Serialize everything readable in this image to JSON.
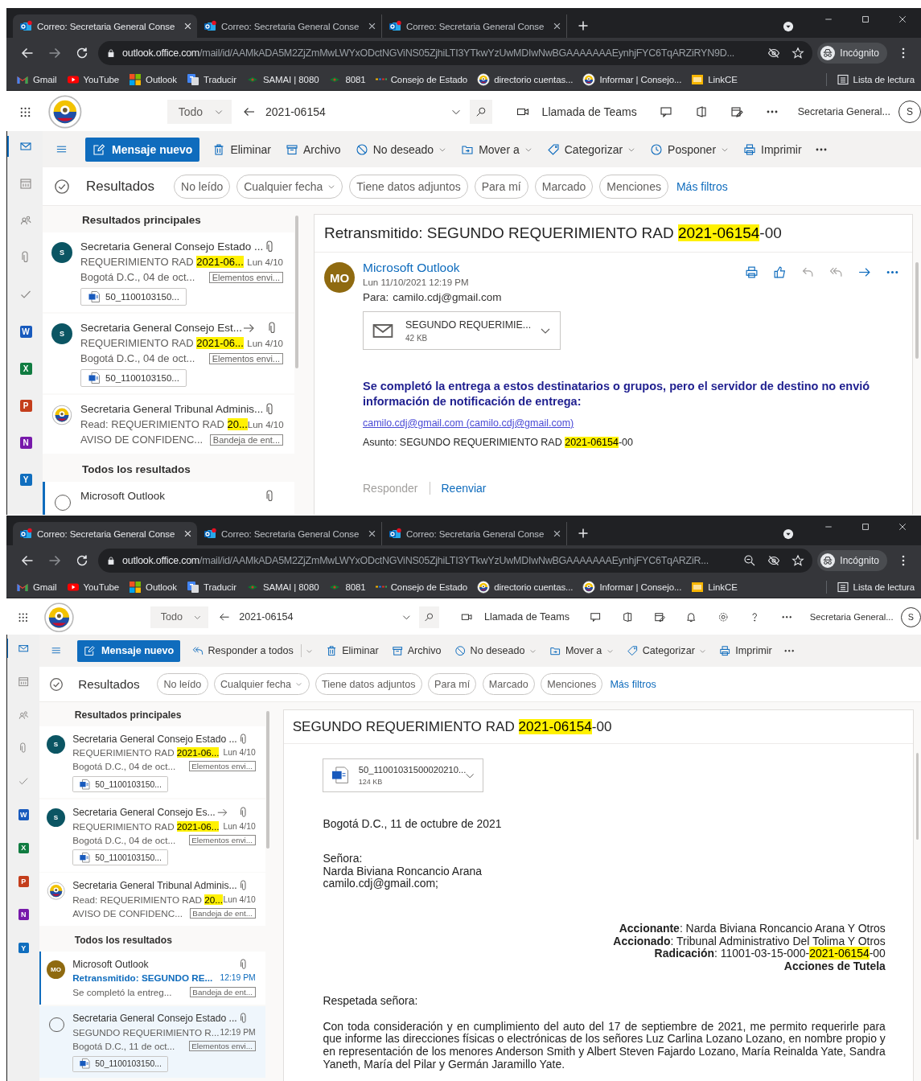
{
  "screens": [
    {
      "browser": {
        "tabs": [
          {
            "title": "Correo: Secretaria General Conse",
            "selected": true
          },
          {
            "title": "Correo: Secretaria General Conse",
            "selected": false
          },
          {
            "title": "Correo: Secretaria General Conse",
            "selected": false
          }
        ],
        "url_host": "outlook.office.com",
        "url_path": "/mail/id/AAMkADA5M2ZjZmMwLWYxODctNGViNS05ZjhiLTI3YTkwYzUwMDIwNwBGAAAAAAAEynhjFYC6TqARZiRYN9D...",
        "profile": "Incógnito",
        "bookmarks": [
          {
            "label": "Gmail"
          },
          {
            "label": "YouTube"
          },
          {
            "label": "Outlook"
          },
          {
            "label": "Traducir"
          },
          {
            "label": "SAMAI | 8080"
          },
          {
            "label": "8081"
          },
          {
            "label": "Consejo de Estado"
          },
          {
            "label": "directorio cuentas..."
          },
          {
            "label": "Informar | Consejo..."
          },
          {
            "label": "LinkCE"
          }
        ],
        "reading_list": "Lista de lectura"
      },
      "outlook": {
        "search_scope": "Todo",
        "search_query": "2021-06154",
        "teams": "Llamada de Teams",
        "account": "Secretaria General...",
        "account_initial": "S",
        "rail": [
          {
            "kind": "mail",
            "selected": true
          },
          {
            "kind": "calendar",
            "selected": false
          },
          {
            "kind": "people",
            "selected": false
          },
          {
            "kind": "clip",
            "selected": false
          },
          {
            "kind": "check",
            "selected": false
          },
          {
            "kind": "app",
            "letter": "W",
            "color": "#185abd",
            "selected": false
          },
          {
            "kind": "app",
            "letter": "X",
            "color": "#107c41",
            "selected": false
          },
          {
            "kind": "app",
            "letter": "P",
            "color": "#c43e1c",
            "selected": false
          },
          {
            "kind": "app",
            "letter": "N",
            "color": "#7719aa",
            "selected": false
          },
          {
            "kind": "app",
            "letter": "Y",
            "color": "#106ebe",
            "selected": false
          }
        ],
        "new_message": "Mensaje nuevo",
        "commands": [
          {
            "label": "Eliminar",
            "kind": "trash",
            "dropdown": false
          },
          {
            "label": "Archivo",
            "kind": "archive",
            "dropdown": false
          },
          {
            "label": "No deseado",
            "kind": "block",
            "dropdown": true
          },
          {
            "label": "Mover a",
            "kind": "move",
            "dropdown": true
          },
          {
            "label": "Categorizar",
            "kind": "tag",
            "dropdown": true
          },
          {
            "label": "Posponer",
            "kind": "clock",
            "dropdown": true
          },
          {
            "label": "Imprimir",
            "kind": "print",
            "dropdown": false
          }
        ],
        "results_label": "Resultados",
        "filters": [
          {
            "label": "No leído",
            "dropdown": false
          },
          {
            "label": "Cualquier fecha",
            "dropdown": true
          },
          {
            "label": "Tiene datos adjuntos",
            "dropdown": false
          },
          {
            "label": "Para mí",
            "dropdown": false
          },
          {
            "label": "Marcado",
            "dropdown": false
          },
          {
            "label": "Menciones",
            "dropdown": false
          }
        ],
        "more_filters": "Más filtros",
        "sections": [
          {
            "title": "Resultados principales",
            "items": [
              {
                "avatar": {
                  "kind": "initial",
                  "text": "S",
                  "color": "#0b5563"
                },
                "sender": "Secretaria General Consejo Estado ...",
                "forwarded": false,
                "attachment": true,
                "subject": [
                  {
                    "text": "REQUERIMIENTO RAD ",
                    "highlight": false
                  },
                  {
                    "text": "2021-06...",
                    "highlight": true
                  }
                ],
                "date": "Lun 4/10",
                "preview": "Bogotá D.C., 04 de oct...",
                "folder": "Elementos envi...",
                "file": "50_1100103150...",
                "unread": false,
                "selected": false,
                "hovered": false
              },
              {
                "avatar": {
                  "kind": "initial",
                  "text": "S",
                  "color": "#0b5563"
                },
                "sender": "Secretaria General Consejo Est...",
                "forwarded": true,
                "attachment": true,
                "subject": [
                  {
                    "text": "REQUERIMIENTO RAD ",
                    "highlight": false
                  },
                  {
                    "text": "2021-06...",
                    "highlight": true
                  }
                ],
                "date": "Lun 4/10",
                "preview": "Bogotá D.C., 04 de oct...",
                "folder": "Elementos envi...",
                "file": "50_1100103150...",
                "unread": false,
                "selected": false,
                "hovered": false
              },
              {
                "avatar": {
                  "kind": "seal"
                },
                "sender": "Secretaria General Tribunal Adminis...",
                "forwarded": false,
                "attachment": true,
                "subject": [
                  {
                    "text": "Read: REQUERIMIENTO RAD ",
                    "highlight": false
                  },
                  {
                    "text": "20...",
                    "highlight": true
                  }
                ],
                "date": "Lun 4/10",
                "preview": "AVISO DE CONFIDENC...",
                "folder": "Bandeja de ent...",
                "unread": false,
                "selected": false,
                "hovered": false
              }
            ]
          },
          {
            "title": "Todos los resultados",
            "items": [
              {
                "avatar": {
                  "kind": "select"
                },
                "sender": "Microsoft Outlook",
                "forwarded": false,
                "attachment": true,
                "unread": false,
                "selected": true,
                "hovered": false
              }
            ]
          }
        ],
        "reading": {
          "title": [
            {
              "text": "Retransmitido: SEGUNDO REQUERIMIENTO RAD ",
              "highlight": false
            },
            {
              "text": "2021-06154",
              "highlight": true
            },
            {
              "text": "-00",
              "highlight": false
            }
          ],
          "sender": {
            "initials": "MO",
            "color": "#8f6a10",
            "name": "Microsoft Outlook",
            "date": "Lun 11/10/2021 12:19 PM",
            "to_label": "Para:",
            "to": "camilo.cdj@gmail.com"
          },
          "attachment": {
            "kind": "envelope",
            "name": "SEGUNDO REQUERIMIE...",
            "size": "42 KB"
          },
          "body": [
            {
              "kind": "notice",
              "text": "Se completó la entrega a estos destinatarios o grupos, pero el servidor de destino no envió información de notificación de entrega:"
            },
            {
              "kind": "link",
              "text": "camilo.cdj@gmail.com (camilo.cdj@gmail.com)"
            },
            {
              "kind": "line",
              "segments": [
                {
                  "text": "Asunto: SEGUNDO REQUERIMIENTO RAD ",
                  "highlight": false
                },
                {
                  "text": "2021-06154",
                  "highlight": true
                },
                {
                  "text": "-00",
                  "highlight": false
                }
              ]
            }
          ],
          "footer": [
            {
              "label": "Responder",
              "disabled": true
            },
            {
              "label": "Reenviar",
              "disabled": false
            }
          ]
        }
      }
    },
    {
      "browser": {
        "tabs": [
          {
            "title": "Correo: Secretaria General Conse",
            "selected": true
          },
          {
            "title": "Correo: Secretaria General Conse",
            "selected": false
          },
          {
            "title": "Correo: Secretaria General Conse",
            "selected": false
          }
        ],
        "url_host": "outlook.office.com",
        "url_path": "/mail/id/AAMkADA5M2ZjZmMwLWYxODctNGViNS05ZjhiLTI3YTkwYzUwMDIwNwBGAAAAAAAEynhjFYC6TqARZiR...",
        "profile": "Incógnito",
        "bookmarks": [
          {
            "label": "Gmail"
          },
          {
            "label": "YouTube"
          },
          {
            "label": "Outlook"
          },
          {
            "label": "Traducir"
          },
          {
            "label": "SAMAI | 8080"
          },
          {
            "label": "8081"
          },
          {
            "label": "Consejo de Estado"
          },
          {
            "label": "directorio cuentas..."
          },
          {
            "label": "Informar | Consejo..."
          },
          {
            "label": "LinkCE"
          }
        ],
        "reading_list": "Lista de lectura"
      },
      "outlook": {
        "search_scope": "Todo",
        "search_query": "2021-06154",
        "teams": "Llamada de Teams",
        "account": "Secretaria General...",
        "account_initial": "S",
        "rail": [
          {
            "kind": "mail",
            "selected": true
          },
          {
            "kind": "calendar",
            "selected": false
          },
          {
            "kind": "people",
            "selected": false
          },
          {
            "kind": "clip",
            "selected": false
          },
          {
            "kind": "check",
            "selected": false
          },
          {
            "kind": "app",
            "letter": "W",
            "color": "#185abd",
            "selected": false
          },
          {
            "kind": "app",
            "letter": "X",
            "color": "#107c41",
            "selected": false
          },
          {
            "kind": "app",
            "letter": "P",
            "color": "#c43e1c",
            "selected": false
          },
          {
            "kind": "app",
            "letter": "N",
            "color": "#7719aa",
            "selected": false
          },
          {
            "kind": "app",
            "letter": "Y",
            "color": "#106ebe",
            "selected": false
          }
        ],
        "new_message": "Mensaje nuevo",
        "commands": [
          {
            "label": "Responder a todos",
            "kind": "replyall",
            "dropdown": true
          },
          {
            "label": "Eliminar",
            "kind": "trash",
            "dropdown": false
          },
          {
            "label": "Archivo",
            "kind": "archive",
            "dropdown": false
          },
          {
            "label": "No deseado",
            "kind": "block",
            "dropdown": true
          },
          {
            "label": "Mover a",
            "kind": "move",
            "dropdown": true
          },
          {
            "label": "Categorizar",
            "kind": "tag",
            "dropdown": true
          },
          {
            "label": "Imprimir",
            "kind": "print",
            "dropdown": false
          }
        ],
        "results_label": "Resultados",
        "filters": [
          {
            "label": "No leído",
            "dropdown": false
          },
          {
            "label": "Cualquier fecha",
            "dropdown": true
          },
          {
            "label": "Tiene datos adjuntos",
            "dropdown": false
          },
          {
            "label": "Para mí",
            "dropdown": false
          },
          {
            "label": "Marcado",
            "dropdown": false
          },
          {
            "label": "Menciones",
            "dropdown": false
          }
        ],
        "more_filters": "Más filtros",
        "sections": [
          {
            "title": "Resultados principales",
            "items": [
              {
                "avatar": {
                  "kind": "initial",
                  "text": "S",
                  "color": "#0b5563"
                },
                "sender": "Secretaria General Consejo Estado ...",
                "forwarded": false,
                "attachment": true,
                "subject": [
                  {
                    "text": "REQUERIMIENTO RAD ",
                    "highlight": false
                  },
                  {
                    "text": "2021-06...",
                    "highlight": true
                  }
                ],
                "date": "Lun 4/10",
                "preview": "Bogotá D.C., 04 de oct...",
                "folder": "Elementos envi...",
                "file": "50_1100103150...",
                "unread": false,
                "selected": false,
                "hovered": false
              },
              {
                "avatar": {
                  "kind": "initial",
                  "text": "S",
                  "color": "#0b5563"
                },
                "sender": "Secretaria General Consejo Es...",
                "forwarded": true,
                "attachment": true,
                "subject": [
                  {
                    "text": "REQUERIMIENTO RAD ",
                    "highlight": false
                  },
                  {
                    "text": "2021-06...",
                    "highlight": true
                  }
                ],
                "date": "Lun 4/10",
                "preview": "Bogotá D.C., 04 de oct...",
                "folder": "Elementos envi...",
                "file": "50_1100103150...",
                "unread": false,
                "selected": false,
                "hovered": false
              },
              {
                "avatar": {
                  "kind": "seal"
                },
                "sender": "Secretaria General Tribunal Adminis...",
                "forwarded": false,
                "attachment": true,
                "subject": [
                  {
                    "text": "Read: REQUERIMIENTO RAD ",
                    "highlight": false
                  },
                  {
                    "text": "20...",
                    "highlight": true
                  }
                ],
                "date": "Lun 4/10",
                "preview": "AVISO DE CONFIDENC...",
                "folder": "Bandeja de ent...",
                "unread": false,
                "selected": false,
                "hovered": false
              }
            ]
          },
          {
            "title": "Todos los resultados",
            "items": [
              {
                "avatar": {
                  "kind": "initial",
                  "text": "MO",
                  "color": "#8f6a10"
                },
                "sender": "Microsoft Outlook",
                "forwarded": false,
                "attachment": true,
                "subject": [
                  {
                    "text": "Retransmitido: SEGUNDO RE...",
                    "highlight": false
                  }
                ],
                "date": "12:19 PM",
                "preview": "Se completó la entreg...",
                "folder": "Bandeja de ent...",
                "unread": true,
                "selected": true,
                "hovered": false
              },
              {
                "avatar": {
                  "kind": "select"
                },
                "sender": "Secretaria General Consejo Estado ...",
                "forwarded": false,
                "attachment": true,
                "subject": [
                  {
                    "text": "SEGUNDO REQUERIMIENTO R...",
                    "highlight": false
                  }
                ],
                "date": "12:19 PM",
                "preview": "Bogotá D.C., 11 de oct...",
                "folder": "Elementos envi...",
                "file": "50_1100103150...",
                "unread": false,
                "selected": false,
                "hovered": true
              }
            ]
          }
        ],
        "reading": {
          "title": [
            {
              "text": "SEGUNDO REQUERIMIENTO RAD ",
              "highlight": false
            },
            {
              "text": "2021-06154",
              "highlight": true
            },
            {
              "text": "-00",
              "highlight": false
            }
          ],
          "attachment": {
            "kind": "word",
            "name": "50_11001031500020210...",
            "size": "124 KB"
          },
          "body": [
            {
              "kind": "para",
              "text": "Bogotá D.C., 11 de octubre de 2021"
            },
            {
              "kind": "address",
              "lines": [
                "Señora:",
                "Narda Biviana Roncancio Arana",
                "camilo.cdj@gmail.com;"
              ]
            },
            {
              "kind": "right",
              "lines": [
                [
                  {
                    "text": "**Accionante**: Narda Biviana Roncancio Arana Y Otros",
                    "highlight": false
                  }
                ],
                [
                  {
                    "text": "**Accionado**: Tribunal Administrativo Del Tolima Y Otros",
                    "highlight": false
                  }
                ],
                [
                  {
                    "text": "**Radicación**: 11001-03-15-000-",
                    "highlight": false
                  },
                  {
                    "text": "2021-06154",
                    "highlight": true
                  },
                  {
                    "text": "-00",
                    "highlight": false
                  }
                ],
                [
                  {
                    "text": "**Acciones de Tutela**",
                    "highlight": false
                  }
                ]
              ]
            },
            {
              "kind": "para",
              "text": "Respetada señora:"
            },
            {
              "kind": "para",
              "text": "Con toda consideración y en cumplimiento del auto del 17 de septiembre de 2021, me permito requerirle para que informe las direcciones físicas o electrónicas de  los señores Luz Carlina Lozano Lozano, en nombre propio y en representación de los menores Anderson Smith y Albert Steven Fajardo Lozano, María Reinalda Yate, Sandra Yaneth, María del Pilar y Germán Jaramillo Yate."
            }
          ]
        }
      }
    }
  ]
}
